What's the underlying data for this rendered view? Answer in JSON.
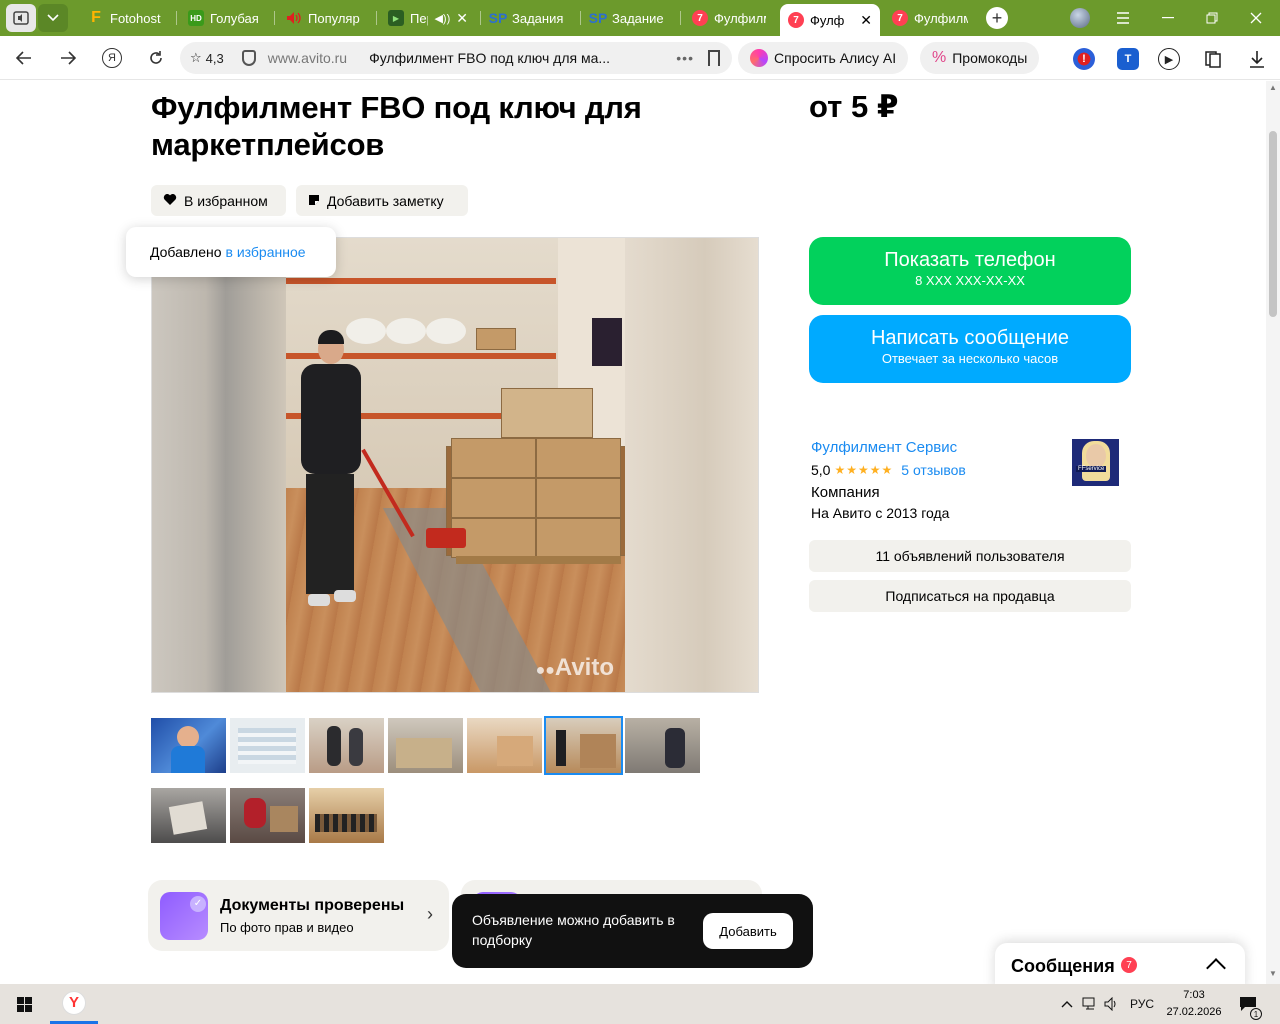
{
  "browser": {
    "tabs": [
      {
        "title": "Fotohost",
        "icon": "fotohost-favicon",
        "color": "#ffb400"
      },
      {
        "title": "Голубая",
        "icon": "hd-favicon",
        "color": "#3a9a1a"
      },
      {
        "title": "Популяр",
        "icon": "speaker-favicon",
        "color": "#e02020"
      },
      {
        "title": "Пер",
        "icon": "video-favicon",
        "color": "#3b7a2a"
      },
      {
        "title": "Задания",
        "icon": "sp-favicon",
        "color": "#2d6fd0"
      },
      {
        "title": "Задание",
        "icon": "sp-favicon",
        "color": "#2d6fd0"
      },
      {
        "title": "Фулфилм",
        "icon": "badge-7-favicon",
        "color": "#ff4053"
      },
      {
        "title": "Фулф",
        "icon": "badge-7-favicon",
        "color": "#ff4053"
      },
      {
        "title": "Фулфилм",
        "icon": "badge-7-favicon",
        "color": "#ff4053"
      }
    ],
    "badge_number": "7",
    "fotohost_letter": "F",
    "hd_letter": "HD",
    "sp_letter": "SP",
    "rating": "4,3",
    "domain": "www.avito.ru",
    "page_title": "Фулфилмент FBO под ключ для ма...",
    "alice_label": "Спросить Алису AI",
    "promo_label": "Промокоды",
    "yandex_glyph": "Я"
  },
  "ad": {
    "title": "Фулфилмент FBO под ключ для маркетплейсов",
    "price": "от 5 ₽",
    "favorite_label": "В избранном",
    "note_label": "Добавить заметку",
    "tooltip_text": "Добавлено",
    "tooltip_link": "в избранное",
    "watermark": "Avito"
  },
  "contact": {
    "phone_label": "Показать телефон",
    "phone_mask": "8 XXX XXX-XX-XX",
    "message_label": "Написать сообщение",
    "message_sub": "Отвечает за несколько часов"
  },
  "seller": {
    "name": "Фулфилмент Сервис",
    "rating": "5,0",
    "stars": "★★★★★",
    "reviews": "5 отзывов",
    "type": "Компания",
    "since": "На Авито с 2013 года",
    "avatar_label": "FFservice",
    "ads_button": "11 объявлений пользователя",
    "subscribe_button": "Подписаться на продавца"
  },
  "cards": {
    "docs_title": "Документы проверены",
    "docs_sub": "По фото прав и видео"
  },
  "toast": {
    "message": "Объявление можно добавить в подборку",
    "button": "Добавить"
  },
  "messages_widget": {
    "label": "Сообщения",
    "count": "7"
  },
  "taskbar": {
    "lang": "РУС",
    "time": "7:03",
    "date": "27.02.2026",
    "notifications": "1"
  }
}
